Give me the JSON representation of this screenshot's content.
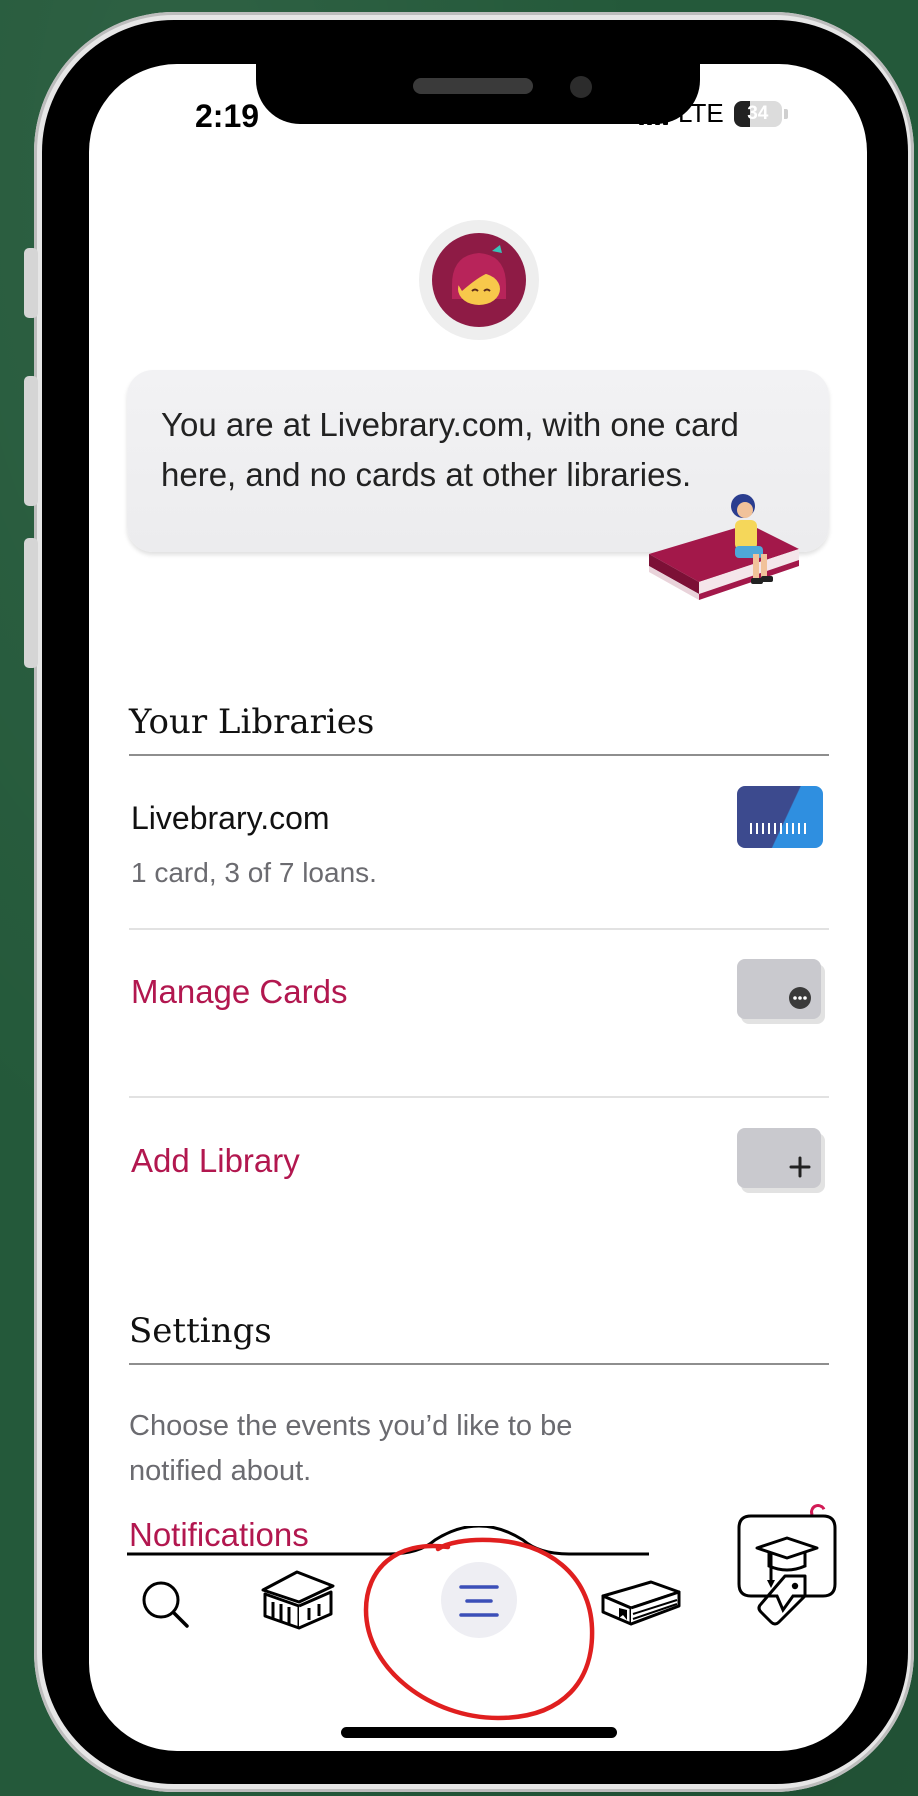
{
  "status_bar": {
    "time": "2:19",
    "network": "LTE",
    "battery_level": "34",
    "battery_fraction": 0.34
  },
  "welcome": {
    "message": "You are at Livebrary.com, with one card here, and no cards at other libraries."
  },
  "libraries": {
    "heading": "Your Libraries",
    "items": [
      {
        "name": "Livebrary.com",
        "detail": "1 card, 3 of 7 loans.",
        "icon": "library-card-icon"
      }
    ],
    "manage_cards_label": "Manage Cards",
    "add_library_label": "Add Library"
  },
  "settings": {
    "heading": "Settings",
    "description": "Choose the events you’d like to be notified about.",
    "notifications_label": "Notifications"
  },
  "tab_bar": {
    "items": [
      {
        "icon": "search-icon",
        "active": false
      },
      {
        "icon": "library-building-icon",
        "active": false
      },
      {
        "icon": "menu-icon",
        "active": true
      },
      {
        "icon": "shelf-books-icon",
        "active": false
      },
      {
        "icon": "tag-icon",
        "active": false
      }
    ]
  },
  "colors": {
    "accent": "#b2174f",
    "background": "#ffffff",
    "chalkboard": "#24593a",
    "annotation": "#e01f1f",
    "card_dark": "#3c4a8e",
    "card_light": "#2f8fe0"
  },
  "annotation": {
    "shape": "circle",
    "target": "menu-tab",
    "color": "#e01f1f"
  }
}
